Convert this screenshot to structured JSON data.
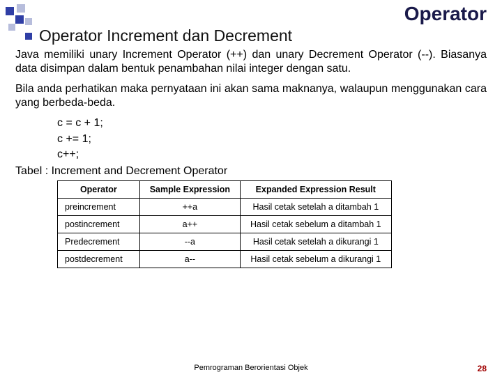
{
  "brand_title": "Operator",
  "heading": "Operator Increment dan Decrement",
  "para1": "Java memiliki unary Increment Operator (++) dan unary Decrement Operator (--). Biasanya data disimpan dalam bentuk penambahan nilai integer dengan satu.",
  "para2": "Bila anda perhatikan maka pernyataan ini akan sama maknanya, walaupun menggunakan cara yang berbeda-beda.",
  "code": [
    "c = c + 1;",
    "c += 1;",
    "c++;"
  ],
  "table_caption": "Tabel : Increment and Decrement Operator",
  "table": {
    "headers": [
      "Operator",
      "Sample Expression",
      "Expanded Expression Result"
    ],
    "rows": [
      {
        "op": "preincrement",
        "sample": "++a",
        "result": "Hasil cetak setelah a ditambah 1"
      },
      {
        "op": "postincrement",
        "sample": "a++",
        "result": "Hasil cetak sebelum a ditambah 1"
      },
      {
        "op": "Predecrement",
        "sample": "--a",
        "result": "Hasil cetak setelah a dikurangi 1"
      },
      {
        "op": "postdecrement",
        "sample": "a--",
        "result": "Hasil cetak sebelum a dikurangi 1"
      }
    ]
  },
  "footer": "Pemrograman Berorientasi Objek",
  "page_number": "28"
}
